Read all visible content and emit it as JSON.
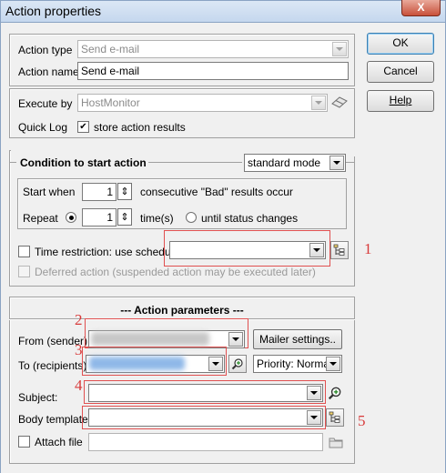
{
  "window": {
    "title": "Action properties",
    "close": "X"
  },
  "buttons": {
    "ok": "OK",
    "cancel": "Cancel",
    "help": "Help"
  },
  "general": {
    "action_type_label": "Action type",
    "action_type_value": "Send e-mail",
    "action_name_label": "Action name",
    "action_name_value": "Send e-mail",
    "execute_by_label": "Execute by",
    "execute_by_value": "HostMonitor",
    "quick_log_label": "Quick Log",
    "quick_log_checkbox_label": "store action results",
    "quick_log_checked": true
  },
  "condition": {
    "group_title": "Condition to start action",
    "mode_value": "standard mode",
    "start_when_label": "Start when",
    "start_when_value": "1",
    "start_when_suffix": "consecutive \"Bad\" results occur",
    "repeat_label": "Repeat",
    "repeat_value": "1",
    "repeat_times_label": "time(s)",
    "until_label": "until status changes",
    "time_restriction_label": "Time restriction: use schedule",
    "deferred_label": "Deferred action (suspended action may be executed later)"
  },
  "parameters": {
    "group_title": "---  Action parameters  ---",
    "from_label": "From (sender):",
    "mailer_button": "Mailer settings..",
    "to_label": "To (recipients):",
    "priority_value": "Priority: Normal",
    "subject_label": "Subject:",
    "body_label": "Body template",
    "attach_label": "Attach file"
  },
  "annotations": [
    "1",
    "2",
    "3",
    "4",
    "5"
  ],
  "colors": {
    "annotation": "#d83a3a",
    "titlebar": "#c5d7ee",
    "dialog_bg": "#f0f0f0"
  }
}
